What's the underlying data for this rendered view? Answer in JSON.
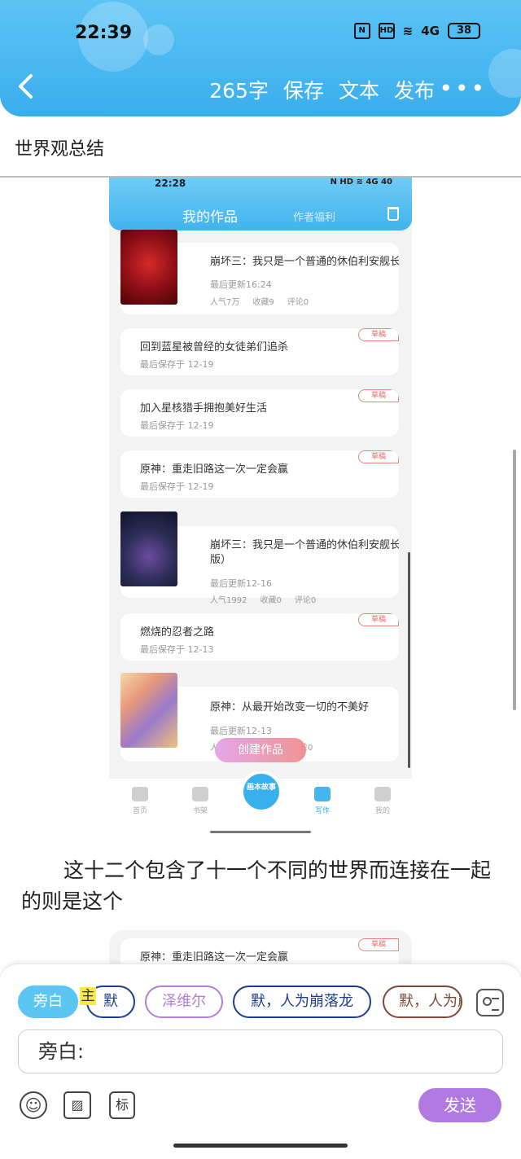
{
  "status": {
    "time": "22:39",
    "nfc": "N",
    "hd": "HD",
    "network": "4G",
    "battery": "38"
  },
  "toolbar": {
    "word_count": "265字",
    "save": "保存",
    "text": "文本",
    "publish": "发布",
    "more": "•••"
  },
  "doc_title": "世界观总结",
  "screenshot": {
    "status_time": "22:28",
    "status_icons": "N HD ≋ 4G 40",
    "header_title": "我的作品",
    "header_tab2": "作者福利",
    "draft_label": "草稿",
    "works": [
      {
        "title": "崩坏三：我只是一个普通的休伯利安舰长",
        "meta": "最后更新16:24",
        "popularity": "人气7万",
        "favorites": "收藏9",
        "comments": "评论0"
      },
      {
        "title": "回到蓝星被曾经的女徒弟们追杀",
        "meta": "最后保存于 12-19"
      },
      {
        "title": "加入星核猎手拥抱美好生活",
        "meta": "最后保存于 12-19"
      },
      {
        "title": "原神：重走旧路这一次一定会赢",
        "meta": "最后保存于 12-19"
      },
      {
        "title": "崩坏三：我只是一个普通的休伯利安舰长",
        "title2": "版）",
        "meta": "最后更新12-16",
        "popularity": "人气1992",
        "favorites": "收藏0",
        "comments": "评论0"
      },
      {
        "title": "燃烧的忍者之路",
        "meta": "最后保存于 12-13"
      },
      {
        "title": "原神：从最开始改变一切的不美好",
        "meta": "最后更新12-13",
        "popularity": "人",
        "comments": "论0"
      }
    ],
    "create_button": "创建作品",
    "nav": {
      "home": "首页",
      "shelf": "书架",
      "center": "画本故事",
      "write": "写作",
      "me": "我的"
    }
  },
  "body_text": "这十二个包含了十一个不同的世界而连接在一起的则是这个",
  "partial_card_title": "原神：重走旧路这一次一定会赢",
  "composer": {
    "chips": [
      "旁白",
      "默",
      "泽维尔",
      "默，人为崩落龙",
      "默，人为崩"
    ],
    "highlight": "主",
    "input_label": "旁白:",
    "tool_mark": "标",
    "send": "发送"
  }
}
